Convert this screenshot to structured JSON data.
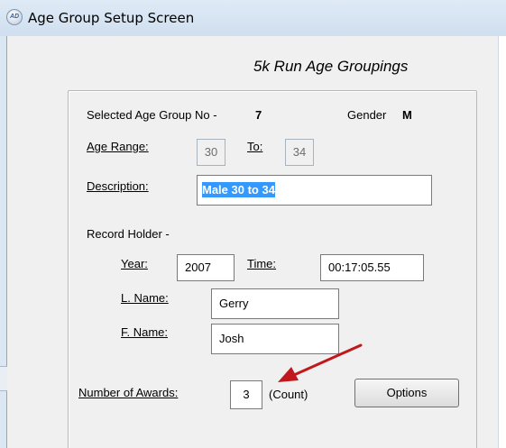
{
  "window": {
    "title": "Age Group Setup Screen",
    "icon": "app-icon"
  },
  "form": {
    "heading": "5k Run  Age Groupings",
    "selected_group_label": "Selected Age Group No -",
    "selected_group_value": "7",
    "gender_label": "Gender",
    "gender_value": "M",
    "age_range_label": "Age Range:",
    "age_from": "30",
    "to_label": "To:",
    "age_to": "34",
    "description_label": "Description:",
    "description_value": "Male 30 to 34",
    "record_holder_label": "Record Holder -",
    "year_label": "Year:",
    "year_value": "2007",
    "time_label": "Time:",
    "time_value": "00:17:05.55",
    "last_name_label": "L. Name:",
    "last_name_value": "Gerry",
    "first_name_label": "F. Name:",
    "first_name_value": "Josh",
    "awards_label": "Number of Awards:",
    "awards_value": "3",
    "count_label": "(Count)",
    "options_button": "Options"
  },
  "annotation": {
    "arrow_color": "#c0181c"
  }
}
